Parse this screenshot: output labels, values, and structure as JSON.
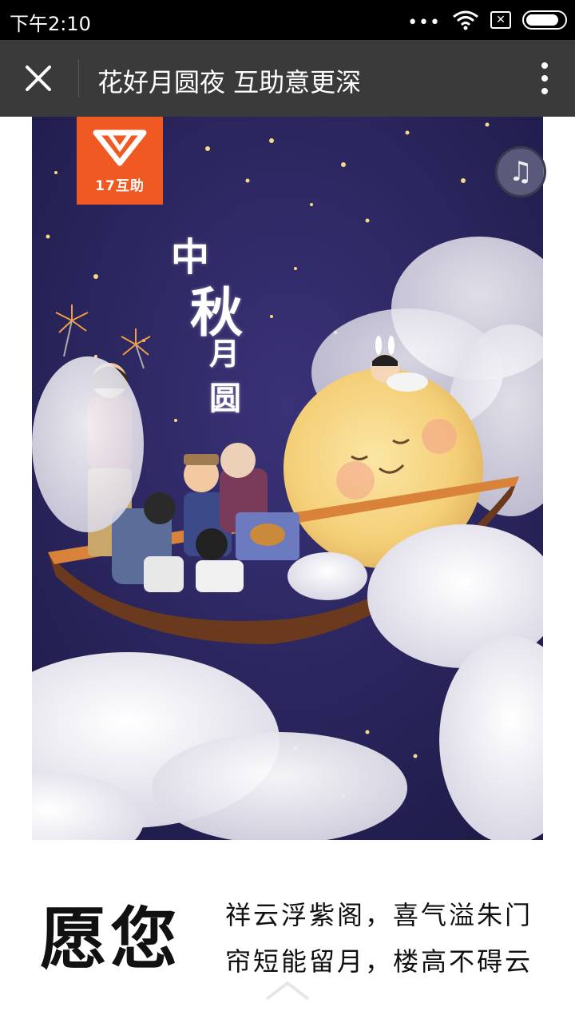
{
  "status_bar": {
    "time": "下午2:10",
    "icons": [
      "dots-icon",
      "wifi-icon",
      "sim-icon",
      "battery-icon"
    ]
  },
  "nav_bar": {
    "title": "花好月圆夜 互助意更深",
    "close_icon": "close-icon",
    "more_icon": "more-vertical-icon"
  },
  "poster": {
    "logo_text": "17互助",
    "title_chars": [
      "中",
      "秋",
      "月",
      "圆"
    ],
    "music_icon": "music-note-icon",
    "colors": {
      "night_sky": "#2a2758",
      "moon": "#f7d98a",
      "logo_orange": "#f05a22",
      "cloud": "#f2f1f4"
    }
  },
  "bottom": {
    "wish_big": "愿您",
    "line1": "祥云浮紫阁，喜气溢朱门",
    "line2": "帘短能留月，楼高不碍云",
    "scroll_icon": "chevron-up-icon"
  }
}
